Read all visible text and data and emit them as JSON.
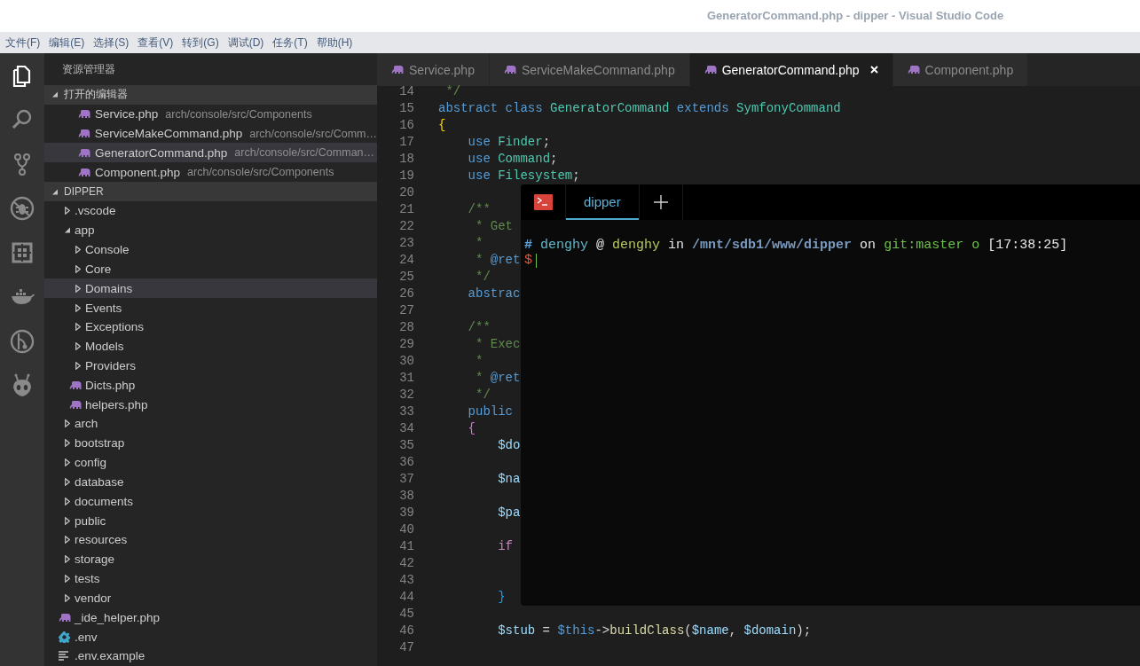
{
  "window": {
    "title": "GeneratorCommand.php - dipper - Visual Studio Code"
  },
  "menu": [
    "文件(F)",
    "编辑(E)",
    "选择(S)",
    "查看(V)",
    "转到(G)",
    "调试(D)",
    "任务(T)",
    "帮助(H)"
  ],
  "activity_bar": [
    {
      "kind": "explorer",
      "selected": true
    },
    {
      "kind": "search",
      "selected": false
    },
    {
      "kind": "source-control",
      "selected": false
    },
    {
      "kind": "debug",
      "selected": false
    },
    {
      "kind": "extensions",
      "selected": false
    },
    {
      "kind": "docker",
      "selected": false
    },
    {
      "kind": "gitlens",
      "selected": false
    },
    {
      "kind": "alien",
      "selected": false
    }
  ],
  "sidebar": {
    "title": "资源管理器",
    "open_editors": {
      "title": "打开的编辑器",
      "expanded": true,
      "items": [
        {
          "name": "Service.php",
          "path": "arch/console/src/Components",
          "selected": false
        },
        {
          "name": "ServiceMakeCommand.php",
          "path": "arch/console/src/Comm…",
          "selected": false
        },
        {
          "name": "GeneratorCommand.php",
          "path": "arch/console/src/Comman…",
          "selected": true
        },
        {
          "name": "Component.php",
          "path": "arch/console/src/Components",
          "selected": false
        }
      ]
    },
    "folder": {
      "title": "DIPPER",
      "expanded": true,
      "items": [
        {
          "name": ".vscode",
          "kind": "folder",
          "expanded": false,
          "selected": false
        },
        {
          "name": "app",
          "kind": "folder",
          "expanded": true,
          "selected": false,
          "children": [
            {
              "name": "Console",
              "kind": "folder",
              "expanded": false,
              "selected": false
            },
            {
              "name": "Core",
              "kind": "folder",
              "expanded": false,
              "selected": false
            },
            {
              "name": "Domains",
              "kind": "folder",
              "expanded": false,
              "selected": true
            },
            {
              "name": "Events",
              "kind": "folder",
              "expanded": false,
              "selected": false
            },
            {
              "name": "Exceptions",
              "kind": "folder",
              "expanded": false,
              "selected": false
            },
            {
              "name": "Models",
              "kind": "folder",
              "expanded": false,
              "selected": false
            },
            {
              "name": "Providers",
              "kind": "folder",
              "expanded": false,
              "selected": false
            },
            {
              "name": "Dicts.php",
              "kind": "php",
              "selected": false
            },
            {
              "name": "helpers.php",
              "kind": "php",
              "selected": false
            }
          ]
        },
        {
          "name": "arch",
          "kind": "folder",
          "expanded": false,
          "selected": false
        },
        {
          "name": "bootstrap",
          "kind": "folder",
          "expanded": false,
          "selected": false
        },
        {
          "name": "config",
          "kind": "folder",
          "expanded": false,
          "selected": false
        },
        {
          "name": "database",
          "kind": "folder",
          "expanded": false,
          "selected": false
        },
        {
          "name": "documents",
          "kind": "folder",
          "expanded": false,
          "selected": false
        },
        {
          "name": "public",
          "kind": "folder",
          "expanded": false,
          "selected": false
        },
        {
          "name": "resources",
          "kind": "folder",
          "expanded": false,
          "selected": false
        },
        {
          "name": "storage",
          "kind": "folder",
          "expanded": false,
          "selected": false
        },
        {
          "name": "tests",
          "kind": "folder",
          "expanded": false,
          "selected": false
        },
        {
          "name": "vendor",
          "kind": "folder",
          "expanded": false,
          "selected": false
        },
        {
          "name": "_ide_helper.php",
          "kind": "php",
          "selected": false
        },
        {
          "name": ".env",
          "kind": "config",
          "selected": false
        },
        {
          "name": ".env.example",
          "kind": "text",
          "selected": false
        }
      ]
    }
  },
  "tabs": [
    {
      "label": "Service.php",
      "selected": false
    },
    {
      "label": "ServiceMakeCommand.php",
      "selected": false
    },
    {
      "label": "GeneratorCommand.php",
      "selected": true
    },
    {
      "label": "Component.php",
      "selected": false
    }
  ],
  "editor": {
    "lines": [
      {
        "number": "14",
        "segments": [
          {
            "text": " */",
            "kind": "comment"
          }
        ]
      },
      {
        "number": "15",
        "segments": [
          {
            "text": "abstract class ",
            "kind": "keyword"
          },
          {
            "text": "GeneratorCommand",
            "kind": "type"
          },
          {
            "text": " extends ",
            "kind": "keyword"
          },
          {
            "text": "SymfonyCommand",
            "kind": "type"
          }
        ]
      },
      {
        "number": "16",
        "segments": [
          {
            "text": "{",
            "kind": "brace1"
          }
        ]
      },
      {
        "number": "17",
        "segments": [
          {
            "text": "    use ",
            "kind": "keyword"
          },
          {
            "text": "Finder",
            "kind": "type"
          },
          {
            "text": ";",
            "kind": "plain"
          }
        ]
      },
      {
        "number": "18",
        "segments": [
          {
            "text": "    use ",
            "kind": "keyword"
          },
          {
            "text": "Command",
            "kind": "type"
          },
          {
            "text": ";",
            "kind": "plain"
          }
        ]
      },
      {
        "number": "19",
        "segments": [
          {
            "text": "    use ",
            "kind": "keyword"
          },
          {
            "text": "Filesystem",
            "kind": "type"
          },
          {
            "text": ";",
            "kind": "plain"
          }
        ]
      },
      {
        "number": "20"
      },
      {
        "number": "21",
        "segments": [
          {
            "text": "    /**",
            "kind": "comment"
          }
        ]
      },
      {
        "number": "22",
        "segments": [
          {
            "text": "     * Get",
            "kind": "comment"
          }
        ]
      },
      {
        "number": "23",
        "segments": [
          {
            "text": "     *",
            "kind": "comment"
          }
        ]
      },
      {
        "number": "24",
        "segments": [
          {
            "text": "     * ",
            "kind": "comment"
          },
          {
            "text": "@ret",
            "kind": "keyword"
          }
        ]
      },
      {
        "number": "25",
        "segments": [
          {
            "text": "     */",
            "kind": "comment"
          }
        ]
      },
      {
        "number": "26",
        "segments": [
          {
            "text": "    abstrac",
            "kind": "keyword"
          }
        ]
      },
      {
        "number": "27"
      },
      {
        "number": "28",
        "segments": [
          {
            "text": "    /**",
            "kind": "comment"
          }
        ]
      },
      {
        "number": "29",
        "segments": [
          {
            "text": "     * Exec",
            "kind": "comment"
          }
        ]
      },
      {
        "number": "30",
        "segments": [
          {
            "text": "     *",
            "kind": "comment"
          }
        ]
      },
      {
        "number": "31",
        "segments": [
          {
            "text": "     * ",
            "kind": "comment"
          },
          {
            "text": "@ret",
            "kind": "keyword"
          }
        ]
      },
      {
        "number": "32",
        "segments": [
          {
            "text": "     */",
            "kind": "comment"
          }
        ]
      },
      {
        "number": "33",
        "segments": [
          {
            "text": "    public",
            "kind": "keyword"
          }
        ]
      },
      {
        "number": "34",
        "segments": [
          {
            "text": "    {",
            "kind": "brace2"
          }
        ]
      },
      {
        "number": "35",
        "segments": [
          {
            "text": "        $do",
            "kind": "var"
          }
        ]
      },
      {
        "number": "36"
      },
      {
        "number": "37",
        "segments": [
          {
            "text": "        $na",
            "kind": "var"
          }
        ]
      },
      {
        "number": "38"
      },
      {
        "number": "39",
        "segments": [
          {
            "text": "        $pa",
            "kind": "var"
          }
        ]
      },
      {
        "number": "40"
      },
      {
        "number": "41",
        "segments": [
          {
            "text": "        if",
            "kind": "control"
          }
        ]
      },
      {
        "number": "42"
      },
      {
        "number": "43"
      },
      {
        "number": "44",
        "segments": [
          {
            "text": "        }",
            "kind": "brace3"
          }
        ]
      },
      {
        "number": "45"
      },
      {
        "number": "46",
        "segments": [
          {
            "text": "        $stub",
            "kind": "var"
          },
          {
            "text": " = ",
            "kind": "plain"
          },
          {
            "text": "$this",
            "kind": "keyword"
          },
          {
            "text": "->",
            "kind": "plain"
          },
          {
            "text": "buildClass",
            "kind": "func"
          },
          {
            "text": "(",
            "kind": "plain"
          },
          {
            "text": "$name",
            "kind": "var"
          },
          {
            "text": ", ",
            "kind": "plain"
          },
          {
            "text": "$domain",
            "kind": "var"
          },
          {
            "text": ");",
            "kind": "plain"
          }
        ]
      },
      {
        "number": "47"
      }
    ]
  },
  "terminal": {
    "tabs": [
      {
        "label": "dipper",
        "selected": true
      }
    ],
    "prompt": [
      {
        "text": "#",
        "kind": "hash"
      },
      {
        "text": " denghy",
        "kind": "user"
      },
      {
        "text": " @ ",
        "kind": "word"
      },
      {
        "text": "denghy",
        "kind": "host"
      },
      {
        "text": " in ",
        "kind": "word"
      },
      {
        "text": "/mnt/sdb1/www/dipper",
        "kind": "path"
      },
      {
        "text": " on ",
        "kind": "word"
      },
      {
        "text": "git:master",
        "kind": "git"
      },
      {
        "text": " o",
        "kind": "status"
      },
      {
        "text": " [17:38:25]",
        "kind": "word"
      }
    ],
    "prompt_symbol": "$"
  }
}
